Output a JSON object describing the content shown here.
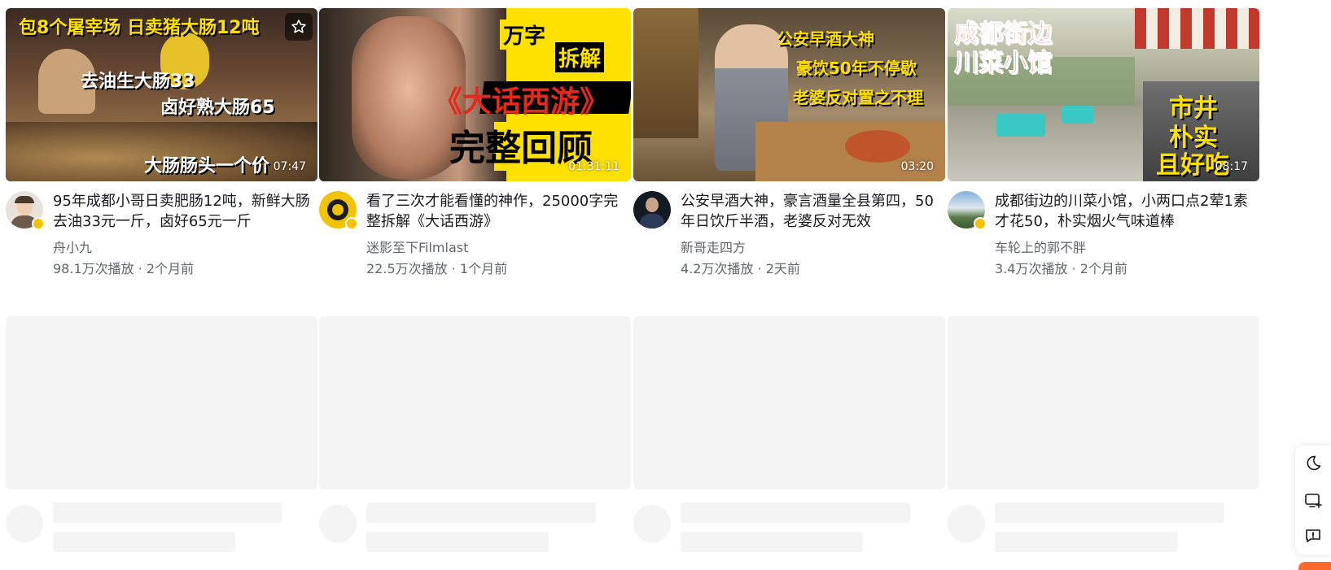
{
  "videos": [
    {
      "thumb_texts": [
        "包8个屠宰场  日卖猪大肠12吨",
        "去油生大肠33",
        "卤好熟大肠65",
        "大肠肠头一个价"
      ],
      "duration": "07:47",
      "title": "95年成都小哥日卖肥肠12吨，新鲜大肠去油33元一斤，卤好65元一斤",
      "author": "舟小九",
      "meta": "98.1万次播放 · 2个月前",
      "has_fav": true
    },
    {
      "thumb_texts": [
        "万字",
        "拆解",
        "《大话西游》",
        "完整回顾"
      ],
      "duration": "01:31:11",
      "title": "看了三次才能看懂的神作，25000字完整拆解《大话西游》",
      "author": "迷影至下Filmlast",
      "meta": "22.5万次播放 · 1个月前",
      "has_fav": false
    },
    {
      "thumb_texts": [
        "公安早酒大神",
        "豪饮50年不停歇",
        "老婆反对置之不理"
      ],
      "duration": "03:20",
      "title": "公安早酒大神，豪言酒量全县第四，50年日饮斤半酒，老婆反对无效",
      "author": "新哥走四方",
      "meta": "4.2万次播放 · 2天前",
      "has_fav": false
    },
    {
      "thumb_texts": [
        "成都街边",
        "川菜小馆",
        "市井",
        "朴实",
        "且好吃"
      ],
      "duration": "08:17",
      "title": "成都街边的川菜小馆，小两口点2荤1素才花50，朴实烟火气味道棒",
      "author": "车轮上的郭不胖",
      "meta": "3.4万次播放 · 2个月前",
      "has_fav": false
    }
  ],
  "icons": {
    "fav": "star-outline-icon",
    "theme": "moon-icon",
    "screen": "screen-plus-icon",
    "feedback": "feedback-icon"
  },
  "colors": {
    "text": "#18191c",
    "secondary": "#61666d",
    "skeleton": "#f4f4f4",
    "accent_yellow": "#ffe100",
    "accent_orange": "#ff6a2b"
  }
}
